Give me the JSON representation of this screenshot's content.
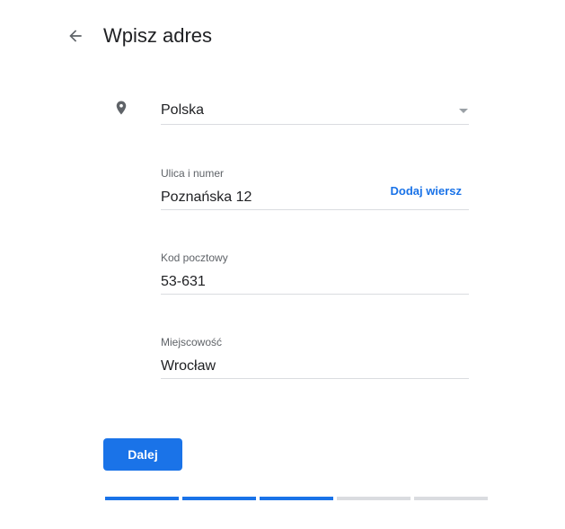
{
  "header": {
    "title": "Wpisz adres"
  },
  "form": {
    "country": {
      "value": "Polska"
    },
    "street": {
      "label": "Ulica i numer",
      "value": "Poznańska 12",
      "add_line_label": "Dodaj wiersz"
    },
    "postal_code": {
      "label": "Kod pocztowy",
      "value": "53-631"
    },
    "city": {
      "label": "Miejscowość",
      "value": "Wrocław"
    }
  },
  "actions": {
    "next_label": "Dalej"
  },
  "progress": {
    "total_steps": 5,
    "completed_steps": 3
  },
  "colors": {
    "accent": "#1a73e8",
    "inactive": "#dadce0"
  },
  "icons": {
    "back": "arrow-back-icon",
    "location": "location-pin-icon",
    "dropdown": "dropdown-caret-icon"
  }
}
